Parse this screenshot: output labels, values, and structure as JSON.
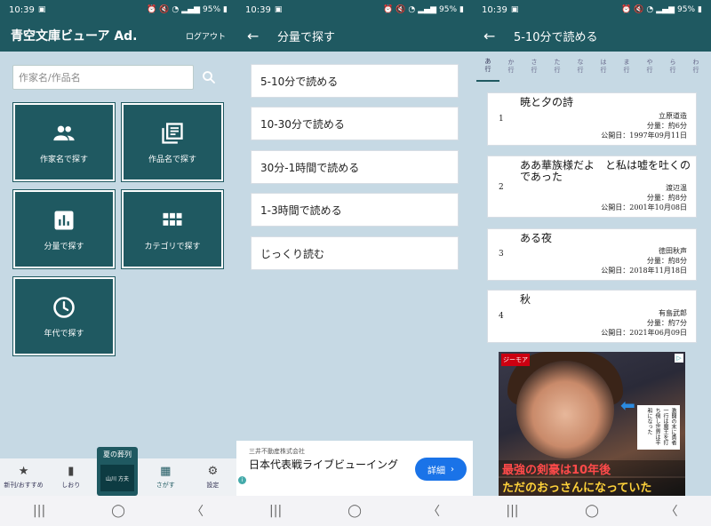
{
  "panel1": {
    "status": {
      "time": "10:39",
      "battery": "95%"
    },
    "app_title": "青空文庫ビューア Ad.",
    "logout": "ログアウト",
    "search_placeholder": "作家名/作品名",
    "tiles": [
      {
        "label": "作家名で探す",
        "icon": "people-icon"
      },
      {
        "label": "作品名で探す",
        "icon": "library-books-icon"
      },
      {
        "label": "分量で探す",
        "icon": "bar-chart-icon"
      },
      {
        "label": "カテゴリで探す",
        "icon": "grid-icon"
      },
      {
        "label": "年代で探す",
        "icon": "clock-icon"
      }
    ],
    "bottom_nav": [
      {
        "label": "新刊/おすすめ",
        "icon": "★"
      },
      {
        "label": "しおり",
        "icon": "▮"
      },
      {
        "label": "さがす",
        "icon": "▦"
      },
      {
        "label": "設定",
        "icon": "⚙"
      }
    ],
    "badge": {
      "title": "夏の葬列",
      "author": "山川 方夫"
    }
  },
  "panel2": {
    "status": {
      "time": "10:39",
      "battery": "95%"
    },
    "title": "分量で探す",
    "items": [
      "5-10分で読める",
      "10-30分で読める",
      "30分-1時間で読める",
      "1-3時間で読める",
      "じっくり読む"
    ],
    "ad": {
      "sponsor": "三井不動産株式会社",
      "text": "日本代表戦ライブビューイング",
      "button": "詳細"
    }
  },
  "panel3": {
    "status": {
      "time": "10:39",
      "battery": "95%"
    },
    "title": "5-10分で読める",
    "kana_tabs": [
      {
        "top": "あ",
        "bottom": "行"
      },
      {
        "top": "か",
        "bottom": "行"
      },
      {
        "top": "さ",
        "bottom": "行"
      },
      {
        "top": "た",
        "bottom": "行"
      },
      {
        "top": "な",
        "bottom": "行"
      },
      {
        "top": "は",
        "bottom": "行"
      },
      {
        "top": "ま",
        "bottom": "行"
      },
      {
        "top": "や",
        "bottom": "行"
      },
      {
        "top": "ら",
        "bottom": "行"
      },
      {
        "top": "わ",
        "bottom": "行"
      }
    ],
    "works": [
      {
        "num": "1",
        "title": "暁と夕の詩",
        "author": "立原道造",
        "length": "分量：約6分",
        "published": "公開日：1997年09月11日"
      },
      {
        "num": "2",
        "title": "ああ華族様だよ　と私は嘘を吐くのであった",
        "author": "渡辺温",
        "length": "分量：約8分",
        "published": "公開日：2001年10月08日"
      },
      {
        "num": "3",
        "title": "ある夜",
        "author": "徳田秋声",
        "length": "分量：約8分",
        "published": "公開日：2018年11月18日"
      },
      {
        "num": "4",
        "title": "秋",
        "author": "有島武郎",
        "length": "分量：約7分",
        "published": "公開日：2021年06月09日"
      }
    ],
    "ad": {
      "logo": "ジーモア",
      "caption": "激闘の末に勇者一行は魔王を打ち倒し世界は平和になった",
      "line1": "最強の剣豪は10年後",
      "line2": "ただのおっさんになっていた"
    }
  }
}
